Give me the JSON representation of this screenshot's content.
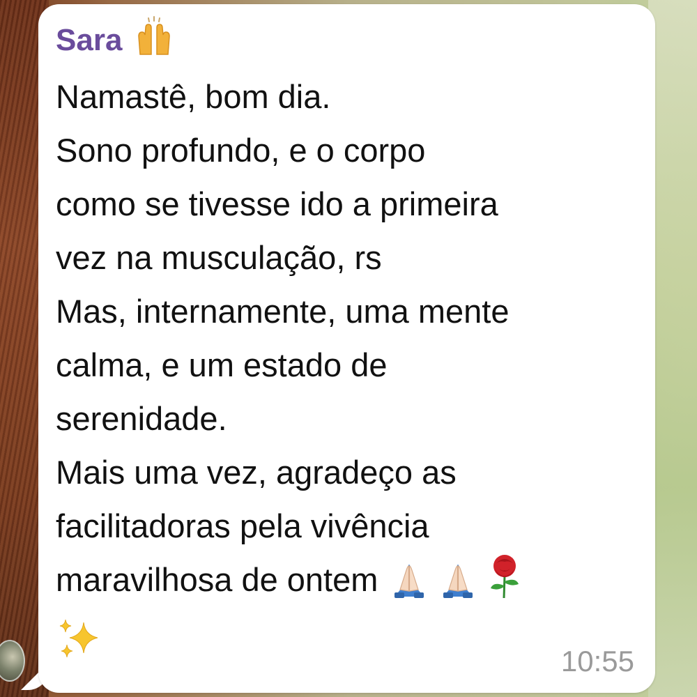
{
  "message": {
    "sender_name": "Sara",
    "sender_emoji": "raised-hands-icon",
    "lines": [
      "Namastê, bom dia.",
      "Sono profundo,  e o corpo",
      "como se tivesse ido a primeira",
      "vez na musculação, rs",
      "Mas, internamente, uma mente",
      "calma, e um estado de",
      "serenidade.",
      "Mais uma vez, agradeço as",
      "facilitadoras pela vivência",
      "maravilhosa de ontem"
    ],
    "trailing_emojis": [
      "folded-hands-icon",
      "folded-hands-icon",
      "rose-icon",
      "sparkles-icon"
    ],
    "time": "10:55"
  },
  "colors": {
    "sender_name": "#6a4c9c",
    "bubble": "#ffffff",
    "text": "#111111",
    "timestamp": "#9a9a9a"
  }
}
